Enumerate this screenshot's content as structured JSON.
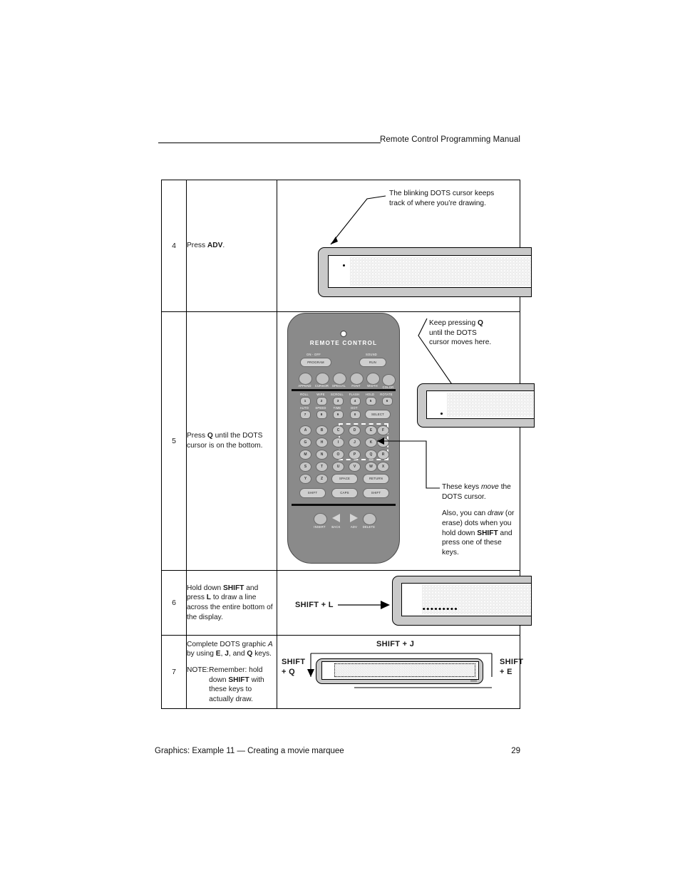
{
  "header": {
    "title": "Remote Control Programming Manual"
  },
  "footer": {
    "left": "Graphics: Example 11 — Creating a movie marquee",
    "page_number": "29"
  },
  "steps": [
    {
      "number": "4",
      "instruction_parts": {
        "pre": "Press ",
        "bold": "ADV",
        "post": "."
      },
      "callout": {
        "line1": "The blinking DOTS cursor keeps",
        "line2": "track of where you’re drawing."
      }
    },
    {
      "number": "5",
      "instruction_parts": {
        "pre": "Press ",
        "bold": "Q",
        "post": " until the DOTS cursor is on the bottom."
      },
      "callout_top": {
        "line1_pre": "Keep pressing ",
        "line1_bold": "Q",
        "line2": "until the DOTS",
        "line3": "cursor moves here."
      },
      "callout_keys": {
        "line1_pre": "These keys ",
        "line1_em": "move",
        "line1_post": " the",
        "line2": "DOTS cursor.",
        "p2_pre": "Also, you can ",
        "p2_em": "draw",
        "p2_mid": " (or erase) dots when you hold down ",
        "p2_bold": "SHIFT",
        "p2_post": " and press one of these keys."
      }
    },
    {
      "number": "6",
      "instruction_parts": {
        "pre": "Hold down ",
        "bold1": "SHIFT",
        "mid": " and press ",
        "bold2": "L",
        "post": " to draw a line across the entire bottom of the display."
      },
      "figure_label": "SHIFT + L"
    },
    {
      "number": "7",
      "instruction_parts": {
        "l1_pre": "Complete DOTS graphic ",
        "l1_em": "A",
        "l2_pre": "by using ",
        "l2_b1": "E",
        "l2_m1": ", ",
        "l2_b2": "J",
        "l2_m2": ", and ",
        "l2_b3": "Q",
        "l2_post": " keys.",
        "note_label": "NOTE:",
        "note_pre": "Remember: hold down ",
        "note_bold": "SHIFT",
        "note_post": " with these keys to actually draw."
      },
      "figure_labels": {
        "top": "SHIFT + J",
        "left_line1": "SHIFT",
        "left_line2": "+ Q",
        "right_line1": "SHIFT",
        "right_line2": "+ E"
      }
    }
  ],
  "remote": {
    "title": "REMOTE  CONTROL",
    "power_label": "ON - OFF",
    "sound_label": "SOUND",
    "program_button": "PROGRAM",
    "run_button": "RUN",
    "function_keys": [
      "APPEND",
      "CURSOR",
      "SPECIAL",
      "FONT",
      "WIDTH",
      "COLOR"
    ],
    "number_row1_labels": [
      "ROLL",
      "WIPE",
      "SCROLL",
      "FLASH",
      "HOLD",
      "ROTATE"
    ],
    "number_row1_keys": [
      "1",
      "2",
      "3",
      "4",
      "5",
      "6"
    ],
    "number_row2_labels": [
      "AUTO",
      "SPEED",
      "TIME",
      "DOT"
    ],
    "number_row2_keys": [
      "7",
      "8",
      "9",
      "0"
    ],
    "select_button": "SELECT",
    "alpha_rows": [
      [
        "A",
        "B",
        "C",
        "D",
        "E",
        "F"
      ],
      [
        "G",
        "H",
        "I",
        "J",
        "K",
        "L"
      ],
      [
        "M",
        "N",
        "O",
        "P",
        "Q",
        "R"
      ],
      [
        "S",
        "T",
        "U",
        "V",
        "W",
        "X"
      ],
      [
        "Y",
        "Z"
      ]
    ],
    "space_button": "SPACE",
    "return_button": "RETURN",
    "shift_left_button": "SHIFT",
    "caps_button": "CAPS",
    "shift_right_button": "SHIFT",
    "bottom_keys": [
      "INSERT",
      "BACK",
      "ADV",
      "DELETE"
    ],
    "highlighted_keys": [
      "D",
      "E",
      "F",
      "J",
      "K",
      "L",
      "P",
      "Q",
      "R"
    ]
  },
  "colors": {
    "remote_body": "#8a8a8a",
    "panel_shell": "#c9c9c9",
    "key_face": "#c6c6c6",
    "screen_bg": "#f2f2f2",
    "ink": "#111111",
    "lit_dot": "#000000"
  }
}
